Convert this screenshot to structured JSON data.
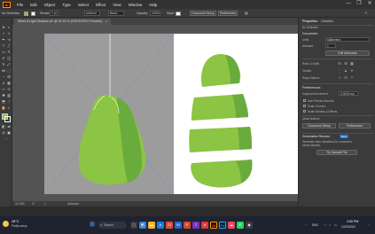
{
  "menubar": {
    "app_logo": "Ai",
    "items": [
      "File",
      "Edit",
      "Object",
      "Type",
      "Select",
      "Effect",
      "View",
      "Window",
      "Help"
    ],
    "window_controls": [
      "—",
      "❐",
      "✕"
    ]
  },
  "controlbar": {
    "selection_label": "No Selection",
    "stroke_label": "Stroke:",
    "stroke_value": "1 pt",
    "brush_label": "Uniform",
    "style_label": "Basic",
    "opacity_label": "Opacity:",
    "opacity_value": "100%",
    "style_field_label": "Style:",
    "document_setup_label": "Document Setup",
    "preferences_label": "Preferences"
  },
  "document": {
    "tab_title": "Week 8 Light Shadow.ai* @ 31.33 % (CMYK/GPU Preview)",
    "zoom_status": "31.33%",
    "rotation_status": "0°",
    "artboard_status": "1",
    "tool_status": "Selection"
  },
  "panel": {
    "tabs": [
      "Properties",
      "Libraries"
    ],
    "no_selection": "No Selection",
    "document_heading": "Document",
    "units_label": "Units",
    "units_value": "Millimeters",
    "artboard_label": "Artboard",
    "artboard_value": "1",
    "edit_artboards": "Edit Artboards",
    "rulers_grids": "Ruler & Grids",
    "guides": "Guides",
    "snap_options": "Snap Options",
    "preferences_heading": "Preferences",
    "keyboard_increment_label": "Keyboard Increment",
    "keyboard_increment_value": "0.3528 mm",
    "use_preview_bounds": "Use Preview Bounds",
    "scale_corners": "Scale Corners",
    "scale_strokes": "Scale Strokes & Effects",
    "quick_actions": "Quick Actions",
    "document_setup_btn": "Document Setup",
    "preferences_btn": "Preferences",
    "recolor_title": "Generative Recolor",
    "recolor_badge": "Beta",
    "recolor_desc": "Generate color variations for a selected vector artwork.",
    "sample_btn": "Try Sample File"
  },
  "taskbar": {
    "weather_temp": "28°C",
    "weather_desc": "Partly sunny",
    "search_placeholder": "Search",
    "lang": "ENG",
    "time": "4:50 PM",
    "date": "10/25/2023"
  },
  "colors": {
    "pear_light": "#8cc443",
    "pear_dark": "#6aab3e",
    "canvas_gray": "#9c9c9c",
    "accent_blue": "#1473e6"
  }
}
